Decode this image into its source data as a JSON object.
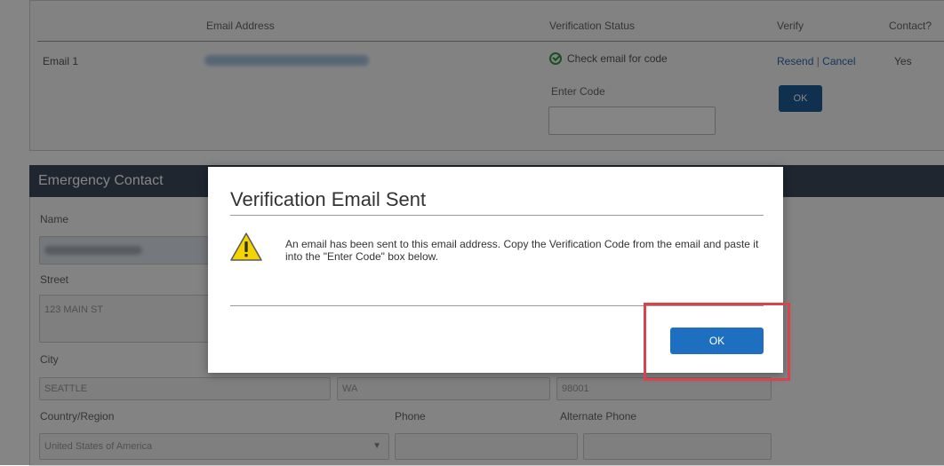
{
  "email_table": {
    "headers": {
      "email_address": "Email Address",
      "verification_status": "Verification Status",
      "verify": "Verify",
      "contact": "Contact?"
    },
    "row": {
      "label": "Email 1",
      "status_text": "Check email for code",
      "resend": "Resend",
      "separator": " | ",
      "cancel": "Cancel",
      "contact_value": "Yes"
    },
    "enter_code_label": "Enter Code",
    "ok_label": "OK"
  },
  "emergency_contact": {
    "title": "Emergency Contact",
    "fields": {
      "name_label": "Name",
      "street_label": "Street",
      "street_value": "123 MAIN ST",
      "city_label": "City",
      "city_value": "SEATTLE",
      "state_value": "WA",
      "zip_value": "98001",
      "country_label": "Country/Region",
      "country_value": "United States of America",
      "phone_label": "Phone",
      "alt_phone_label": "Alternate Phone"
    }
  },
  "modal": {
    "title": "Verification Email Sent",
    "message": "An email has been sent to this email address. Copy the Verification Code from the email and paste it into the \"Enter Code\" box below.",
    "ok_label": "OK"
  },
  "colors": {
    "primary_button": "#1f6fc1",
    "section_header": "#3c4a5c",
    "highlight_border": "#d9434b",
    "success": "#2e9a3f",
    "warning": "#f3d400"
  }
}
